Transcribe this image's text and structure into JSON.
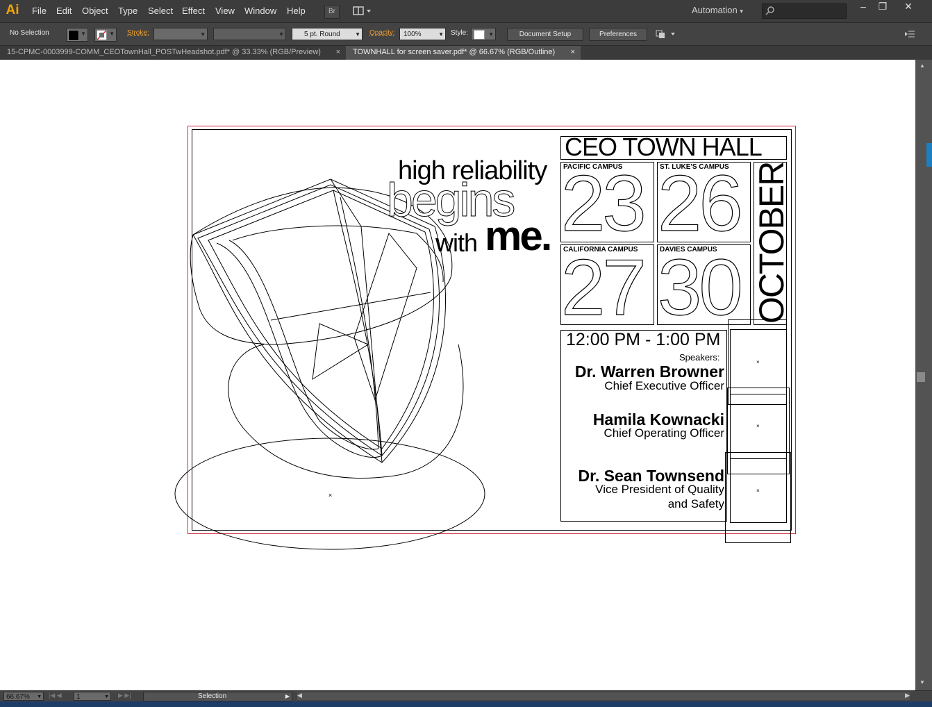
{
  "app": {
    "logo": "Ai"
  },
  "menu": {
    "items": [
      "File",
      "Edit",
      "Object",
      "Type",
      "Select",
      "Effect",
      "View",
      "Window",
      "Help"
    ],
    "bridge_button": "Br",
    "workspace": "Automation",
    "search_placeholder": ""
  },
  "control": {
    "selection": "No Selection",
    "fill_color": "#000000",
    "stroke_label": "Stroke:",
    "brush": "5 pt. Round",
    "opacity_label": "Opacity:",
    "opacity_value": "100%",
    "style_label": "Style:",
    "doc_setup": "Document Setup",
    "preferences": "Preferences"
  },
  "tabs": [
    {
      "label": "15-CPMC-0003999-COMM_CEOTownHall_POSTwHeadshot.pdf* @ 33.33% (RGB/Preview)",
      "close": "×"
    },
    {
      "label": "TOWNHALL for screen saver.pdf* @ 66.67% (RGB/Outline)",
      "close": "×"
    }
  ],
  "artwork": {
    "headline1": "high reliability",
    "headline2": "begins",
    "headline3_a": "with",
    "headline3_b": "me.",
    "title": "CEO TOWN HALL",
    "month": "OCTOBER",
    "campuses": [
      {
        "name": "PACIFIC CAMPUS",
        "date": "23"
      },
      {
        "name": "ST. LUKE'S CAMPUS",
        "date": "26"
      },
      {
        "name": "CALIFORNIA CAMPUS",
        "date": "27"
      },
      {
        "name": "DAVIES CAMPUS",
        "date": "30"
      }
    ],
    "time": "12:00 PM - 1:00 PM",
    "speakers_label": "Speakers:",
    "speakers": [
      {
        "name": "Dr. Warren Browner",
        "role": "Chief Executive Officer"
      },
      {
        "name": "Hamila Kownacki",
        "role": "Chief Operating Officer"
      },
      {
        "name": "Dr. Sean Townsend",
        "role": "Vice President of Quality",
        "role2": "and Safety"
      }
    ]
  },
  "status": {
    "zoom": "66.67%",
    "page": "1",
    "tool": "Selection"
  },
  "colors": {
    "accent_orange": "#f7a300",
    "artboard_red": "#cc2233",
    "scroll_blue": "#1e7fc0"
  }
}
